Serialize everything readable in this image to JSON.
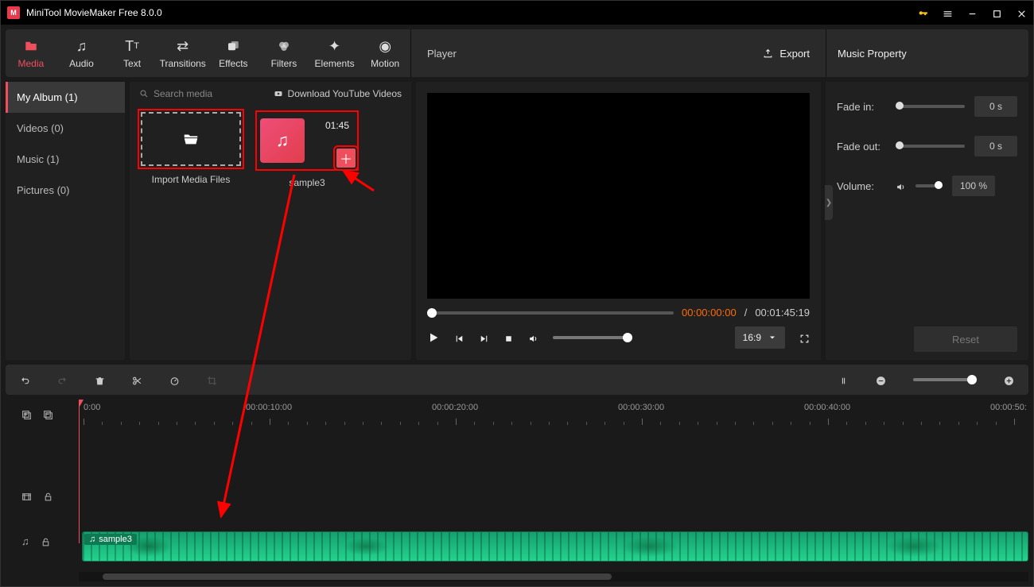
{
  "title": "MiniTool MovieMaker Free 8.0.0",
  "tabs": {
    "media": "Media",
    "audio": "Audio",
    "text": "Text",
    "transitions": "Transitions",
    "effects": "Effects",
    "filters": "Filters",
    "elements": "Elements",
    "motion": "Motion"
  },
  "player_label": "Player",
  "export_label": "Export",
  "props_title": "Music Property",
  "sidebar": {
    "my_album": "My Album (1)",
    "videos": "Videos (0)",
    "music": "Music (1)",
    "pictures": "Pictures (0)"
  },
  "media": {
    "search_placeholder": "Search media",
    "download_yt": "Download YouTube Videos",
    "import_label": "Import Media Files",
    "clip_name": "sample3",
    "clip_duration": "01:45"
  },
  "playback": {
    "current": "00:00:00:00",
    "total": "00:01:45:19",
    "aspect": "16:9"
  },
  "props": {
    "fade_in_label": "Fade in:",
    "fade_in_value": "0 s",
    "fade_out_label": "Fade out:",
    "fade_out_value": "0 s",
    "volume_label": "Volume:",
    "volume_value": "100 %",
    "reset": "Reset"
  },
  "timeline": {
    "marks": [
      "0:00",
      "00:00:10:00",
      "00:00:20:00",
      "00:00:30:00",
      "00:00:40:00",
      "00:00:50:"
    ],
    "clip_label": "sample3"
  }
}
